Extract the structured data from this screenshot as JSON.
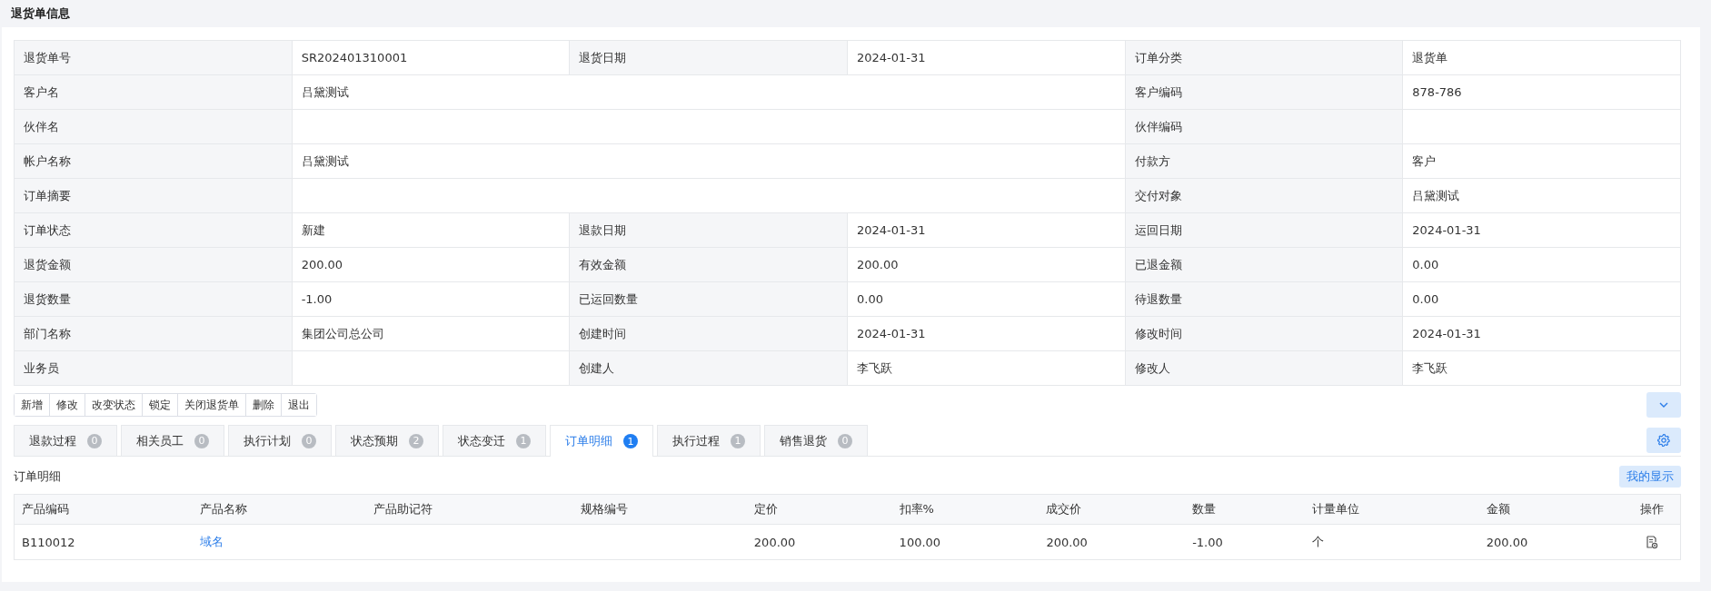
{
  "header": {
    "title": "退货单信息"
  },
  "form": {
    "rows": [
      [
        {
          "label": "退货单号",
          "value": "SR202401310001",
          "wide": false
        },
        {
          "label": "退货日期",
          "value": "2024-01-31",
          "wide": false
        },
        {
          "label": "订单分类",
          "value": "退货单",
          "wide": false
        }
      ],
      [
        {
          "label": "客户名",
          "value": "吕黛测试",
          "wide": true
        },
        {
          "label": "客户编码",
          "value": "878-786",
          "wide": false
        }
      ],
      [
        {
          "label": "伙伴名",
          "wide": true
        },
        {
          "label": "伙伴编码",
          "wide": false
        }
      ],
      [
        {
          "label": "帐户名称",
          "value": "吕黛测试",
          "wide": true
        },
        {
          "label": "付款方",
          "value": "客户",
          "wide": false
        }
      ],
      [
        {
          "label": "订单摘要",
          "wide": true
        },
        {
          "label": "交付对象",
          "value": "吕黛测试",
          "wide": false
        }
      ],
      [
        {
          "label": "订单状态",
          "value": "新建",
          "wide": false
        },
        {
          "label": "退款日期",
          "value": "2024-01-31",
          "wide": false
        },
        {
          "label": "运回日期",
          "value": "2024-01-31",
          "wide": false
        }
      ],
      [
        {
          "label": "退货金额",
          "value": "200.00",
          "wide": false
        },
        {
          "label": "有效金额",
          "value": "200.00",
          "wide": false
        },
        {
          "label": "已退金额",
          "value": "0.00",
          "wide": false
        }
      ],
      [
        {
          "label": "退货数量",
          "value": "-1.00",
          "wide": false
        },
        {
          "label": "已运回数量",
          "value": "0.00",
          "wide": false
        },
        {
          "label": "待退数量",
          "value": "0.00",
          "wide": false
        }
      ],
      [
        {
          "label": "部门名称",
          "value": "集团公司总公司",
          "wide": false
        },
        {
          "label": "创建时间",
          "value": "2024-01-31",
          "wide": false
        },
        {
          "label": "修改时间",
          "value": "2024-01-31",
          "wide": false
        }
      ],
      [
        {
          "label": "业务员",
          "wide": false
        },
        {
          "label": "创建人",
          "value": "李飞跃",
          "wide": false
        },
        {
          "label": "修改人",
          "value": "李飞跃",
          "wide": false
        }
      ]
    ]
  },
  "toolbar": [
    "新增",
    "修改",
    "改变状态",
    "锁定",
    "关闭退货单",
    "删除",
    "退出"
  ],
  "tabs": [
    {
      "label": "退款过程",
      "count": "0",
      "selected": false
    },
    {
      "label": "相关员工",
      "count": "0",
      "selected": false
    },
    {
      "label": "执行计划",
      "count": "0",
      "selected": false
    },
    {
      "label": "状态预期",
      "count": "2",
      "selected": false
    },
    {
      "label": "状态变迁",
      "count": "1",
      "selected": false
    },
    {
      "label": "订单明细",
      "count": "1",
      "selected": true
    },
    {
      "label": "执行过程",
      "count": "1",
      "selected": false
    },
    {
      "label": "销售退货",
      "count": "0",
      "selected": false
    }
  ],
  "section": {
    "title": "订单明细",
    "button": "我的显示"
  },
  "table": {
    "columns": [
      "产品编码",
      "产品名称",
      "产品助记符",
      "规格编号",
      "定价",
      "扣率%",
      "成交价",
      "数量",
      "计量单位",
      "金额",
      "操作"
    ],
    "rows": [
      {
        "cells": [
          {
            "kind": "text",
            "text": "B110012"
          },
          {
            "kind": "link",
            "text": "域名"
          },
          {
            "kind": "empty"
          },
          {
            "kind": "empty"
          },
          {
            "kind": "text",
            "text": "200.00"
          },
          {
            "kind": "text",
            "text": "100.00"
          },
          {
            "kind": "text",
            "text": "200.00"
          },
          {
            "kind": "text",
            "text": "-1.00"
          },
          {
            "kind": "text",
            "text": "个"
          },
          {
            "kind": "text",
            "text": "200.00"
          },
          {
            "kind": "action"
          }
        ]
      }
    ]
  }
}
